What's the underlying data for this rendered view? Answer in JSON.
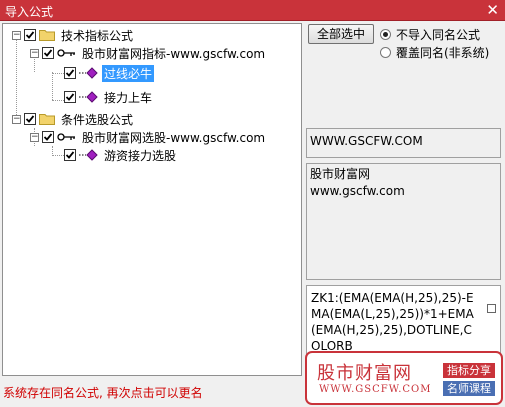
{
  "window": {
    "title": "导入公式",
    "close_glyph": "✕"
  },
  "tree": {
    "groups": [
      {
        "label": "技术指标公式",
        "children": [
          {
            "label": "股市财富网指标-www.gscfw.com",
            "items": [
              {
                "label": "过线必牛",
                "selected": true
              },
              {
                "label": "接力上车",
                "selected": false
              }
            ]
          }
        ]
      },
      {
        "label": "条件选股公式",
        "children": [
          {
            "label": "股市财富网选股-www.gscfw.com",
            "items": [
              {
                "label": "游资接力选股",
                "selected": false
              }
            ]
          }
        ]
      }
    ]
  },
  "toolbar": {
    "select_all_label": "全部选中"
  },
  "options": {
    "no_import_same_name": "不导入同名公式",
    "overwrite_same_name": "覆盖同名(非系统)"
  },
  "info": {
    "source": "WWW.GSCFW.COM",
    "description_line1": "股市财富网",
    "description_line2": "www.gscfw.com",
    "formula_text": "ZK1:(EMA(EMA(H,25),25)-EMA(EMA(L,25),25))*1+EMA(EMA(H,25),25),DOTLINE,COLORB"
  },
  "watermark": {
    "brand": "股市财富网",
    "url": "WWW.GSCFW.COM",
    "tag1": "指标分享",
    "tag2": "名师课程"
  },
  "status": {
    "message": "系统存在同名公式, 再次点击可以更名"
  },
  "colors": {
    "title_bar": "#c9333a",
    "selection": "#3399ff",
    "status_text": "#d00000",
    "formula_icon": "#a020c0"
  }
}
